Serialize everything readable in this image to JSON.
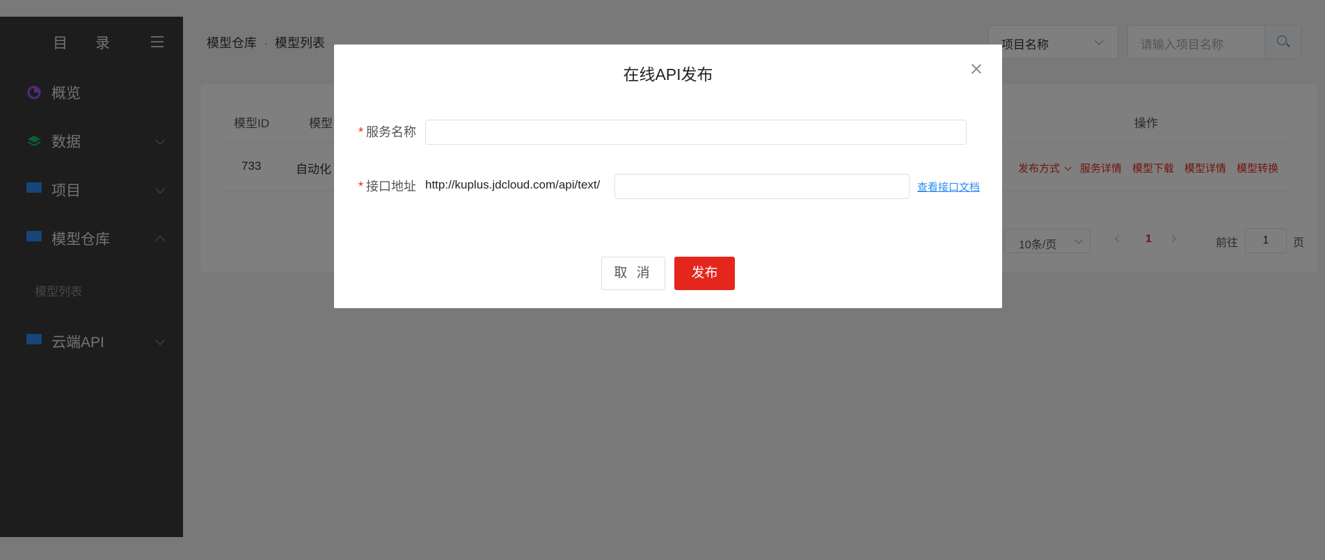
{
  "sidebar": {
    "title_part1": "目",
    "title_part2": "录",
    "items": [
      {
        "label": "概览"
      },
      {
        "label": "数据"
      },
      {
        "label": "项目"
      },
      {
        "label": "模型仓库"
      },
      {
        "label": "模型列表"
      },
      {
        "label": "云端API"
      }
    ]
  },
  "breadcrumb": {
    "item1": "模型仓库",
    "sep": "·",
    "item2": "模型列表"
  },
  "filter": {
    "select_value": "项目名称",
    "search_placeholder": "请输入项目名称"
  },
  "table": {
    "headers": {
      "id": "模型ID",
      "name": "模型",
      "ops": "操作"
    },
    "row": {
      "id": "733",
      "name": "自动化",
      "ops": [
        "发布方式",
        "服务详情",
        "模型下载",
        "模型详情",
        "模型转换"
      ]
    }
  },
  "pagination": {
    "page_size": "10条/页",
    "current": "1",
    "goto_label": "前往",
    "goto_value": "1",
    "unit": "页"
  },
  "modal": {
    "title": "在线API发布",
    "field1_label": "服务名称",
    "field2_label": "接口地址",
    "url_prefix": "http://kuplus.jdcloud.com/api/text/",
    "doc_link": "查看接口文档",
    "cancel": "取 消",
    "submit": "发布",
    "required_mark": "*"
  },
  "colors": {
    "accent": "#e5261d",
    "link": "#2d8cf0"
  }
}
